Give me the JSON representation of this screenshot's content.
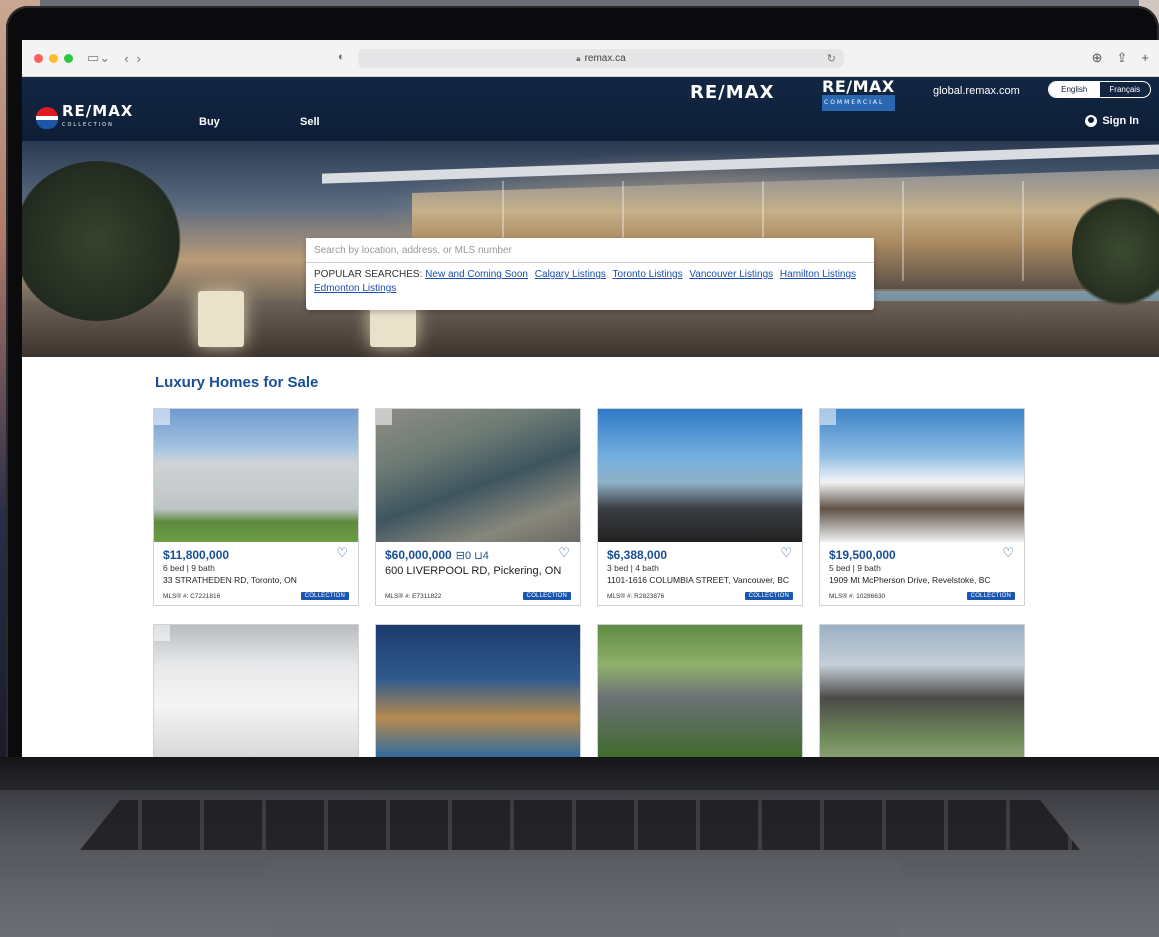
{
  "browser": {
    "url": "remax.ca"
  },
  "header": {
    "brand_remax": "RE/MAX",
    "brand_commercial": "RE/MAX",
    "brand_commercial_sub": "COMMERCIAL",
    "global_link": "global.remax.com",
    "lang_english": "English",
    "lang_french": "Français",
    "logo_text": "RE/MAX",
    "logo_sub": "COLLECTION",
    "nav_buy": "Buy",
    "nav_sell": "Sell",
    "sign_in": "Sign In"
  },
  "search": {
    "placeholder": "Search by location, address, or MLS number",
    "popular_label": "POPULAR SEARCHES:",
    "links": [
      "New and Coming Soon",
      "Calgary Listings",
      "Toronto Listings",
      "Vancouver Listings",
      "Hamilton Listings",
      "Edmonton Listings"
    ]
  },
  "section": {
    "title": "Luxury Homes for Sale"
  },
  "listings": [
    {
      "price": "$11,800,000",
      "meta": "6 bed | 9 bath",
      "address": "33 STRATHEDEN RD, Toronto, ON",
      "mls": "MLS® #: C7221816",
      "badge": "COLLECTION"
    },
    {
      "price": "$60,000,000",
      "beds_baths": "⊟0 ⊔4",
      "address": "600 LIVERPOOL RD, Pickering, ON",
      "mls": "MLS® #: E7311822",
      "badge": "COLLECTION"
    },
    {
      "price": "$6,388,000",
      "meta": "3 bed | 4 bath",
      "address": "1101-1616 COLUMBIA STREET, Vancouver, BC",
      "mls": "MLS® #: R2823876",
      "badge": "COLLECTION"
    },
    {
      "price": "$19,500,000",
      "meta": "5 bed | 9 bath",
      "address": "1909 Mt McPherson Drive, Revelstoke, BC",
      "mls": "MLS® #: 10286630",
      "badge": "COLLECTION"
    }
  ]
}
